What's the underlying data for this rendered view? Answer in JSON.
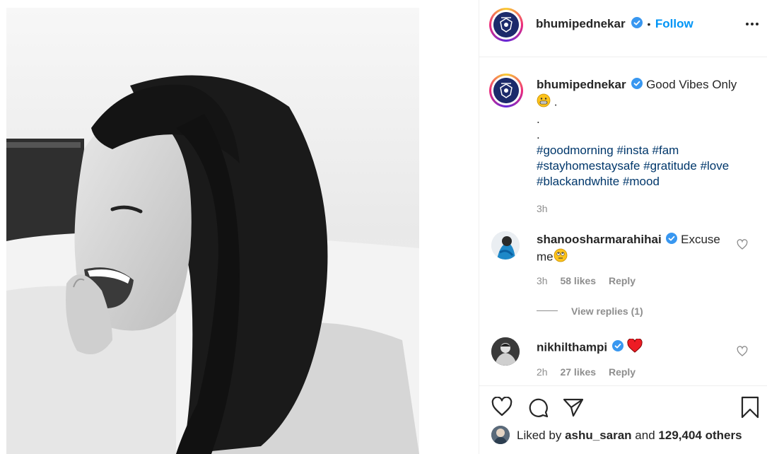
{
  "header": {
    "username": "bhumipednekar",
    "separator": "•",
    "follow_label": "Follow",
    "more_icon": "more-horizontal-icon"
  },
  "caption": {
    "username": "bhumipednekar",
    "text": "Good Vibes Only",
    "emoji_trail": ".",
    "dot1": ".",
    "dot2": ".",
    "hashtags_line1": [
      "#goodmorning",
      "#insta",
      "#fam"
    ],
    "hashtags_line2": [
      "#stayhomestaysafe",
      "#gratitude",
      "#love"
    ],
    "hashtags_line3": [
      "#blackandwhite",
      "#mood"
    ],
    "time": "3h"
  },
  "comments": [
    {
      "username": "shanoosharmarahihai",
      "text_part1": "Excuse",
      "text_part2": "me",
      "time": "3h",
      "likes": "58 likes",
      "reply_label": "Reply",
      "view_replies": "View replies (1)"
    },
    {
      "username": "nikhilthampi",
      "time": "2h",
      "likes": "27 likes",
      "reply_label": "Reply"
    }
  ],
  "footer": {
    "liked_by_prefix": "Liked by",
    "liked_by_user": "ashu_saran",
    "liked_by_and": "and",
    "liked_by_count": "129,404 others"
  },
  "colors": {
    "accent": "#0095f6",
    "verified": "#3897f0",
    "hashtag": "#00376b",
    "heart": "#ed4956",
    "muted": "#8e8e8e"
  }
}
